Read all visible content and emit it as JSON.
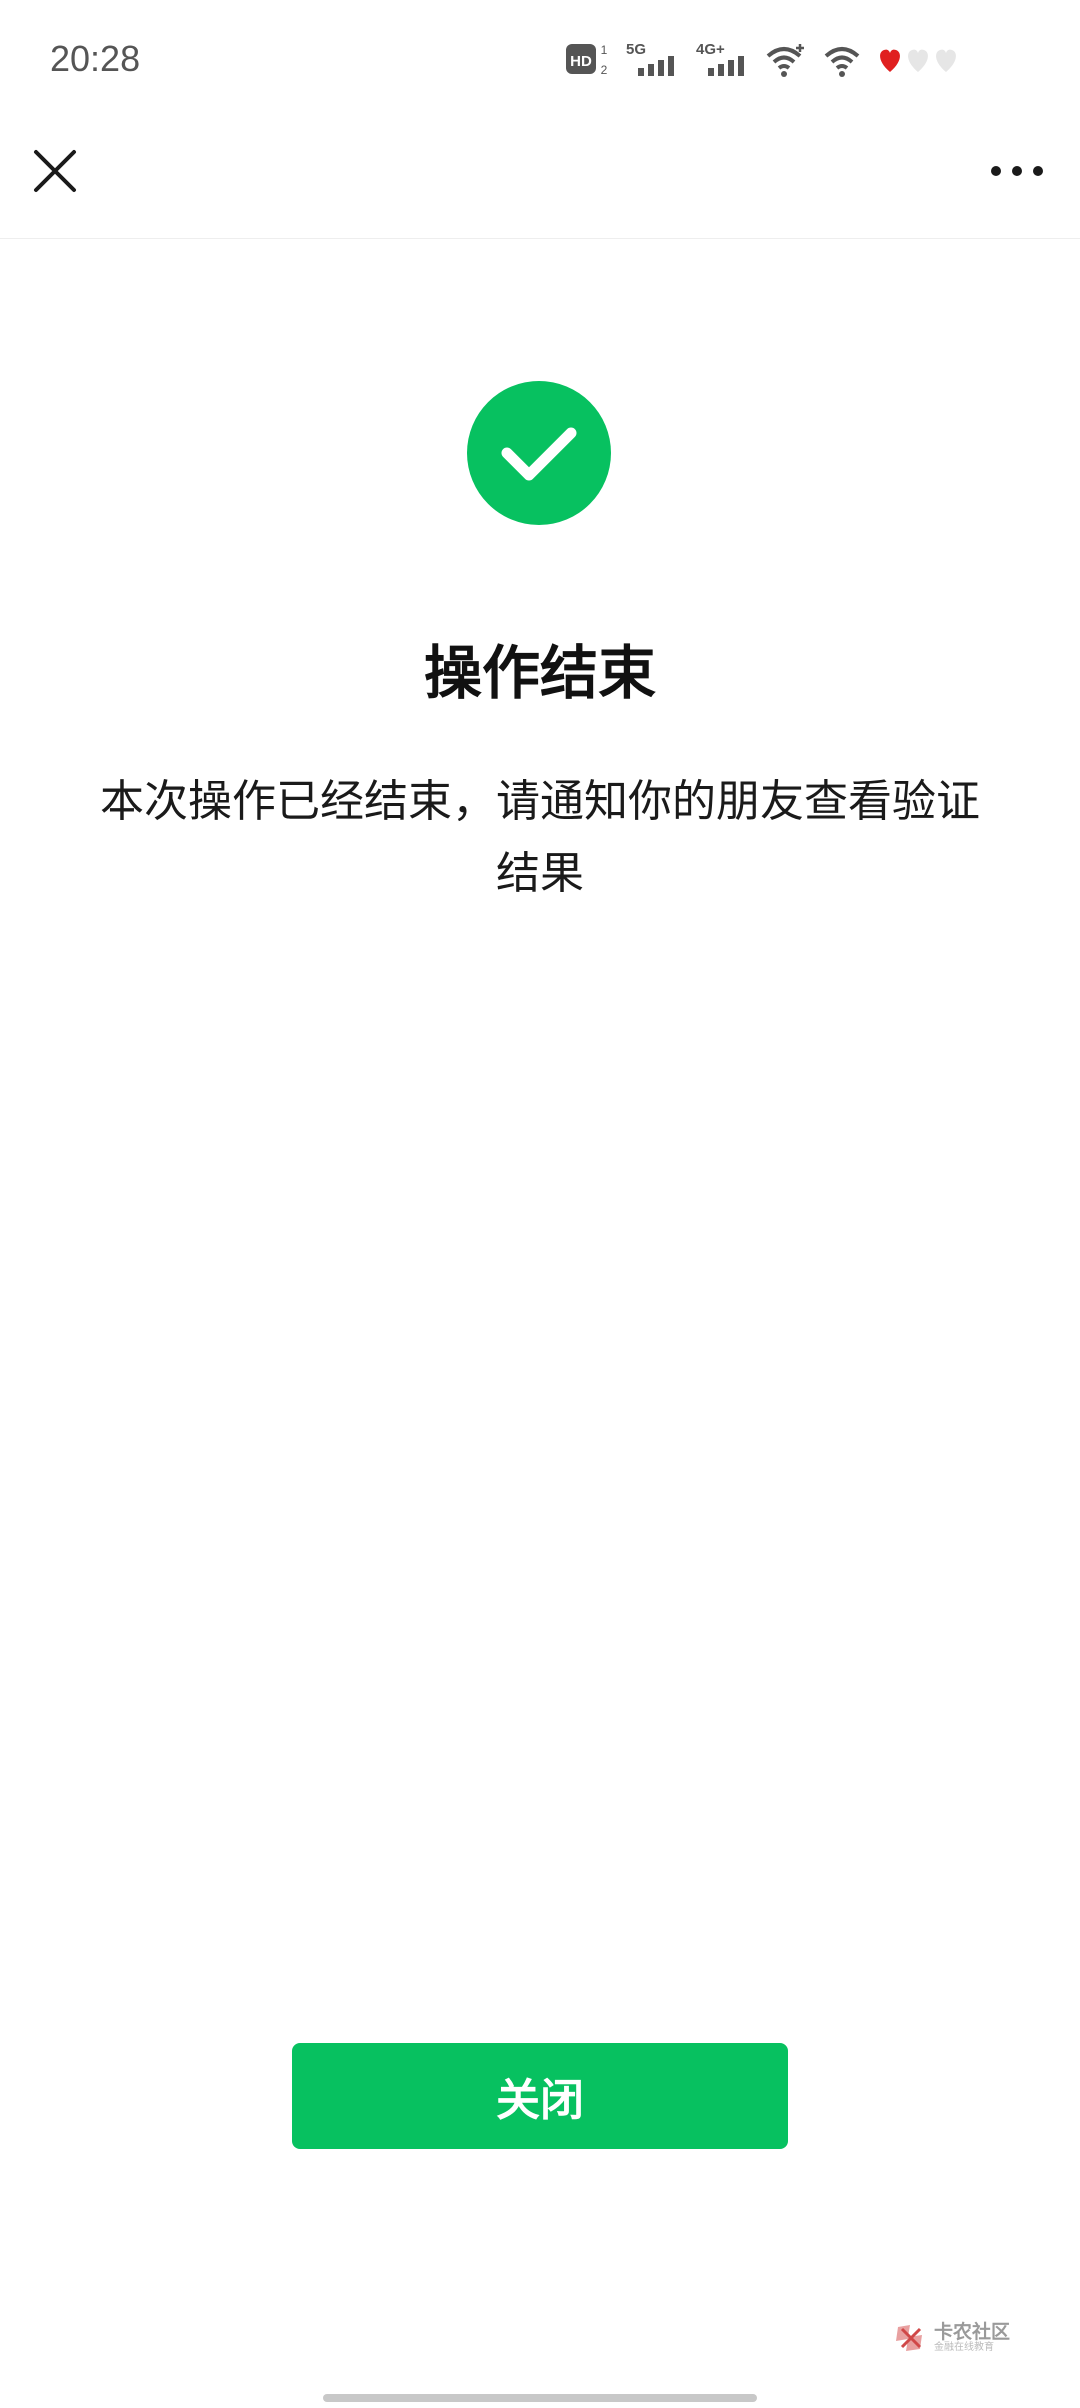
{
  "status_bar": {
    "time": "20:28",
    "hd_label": "HD",
    "sim1_label": "1",
    "sim2_label": "2",
    "net1": "5G",
    "net2": "4G+"
  },
  "nav": {
    "close_icon": "close-icon",
    "more_icon": "more-icon"
  },
  "result": {
    "icon": "success-check-icon",
    "title": "操作结束",
    "description": "本次操作已经结束，请通知你的朋友查看验证结果"
  },
  "footer": {
    "close_label": "关闭"
  },
  "watermark": {
    "title": "卡农社区",
    "subtitle": "金融在线教育"
  },
  "colors": {
    "accent": "#07c160",
    "text": "#111111",
    "heart_red": "#e02020"
  }
}
